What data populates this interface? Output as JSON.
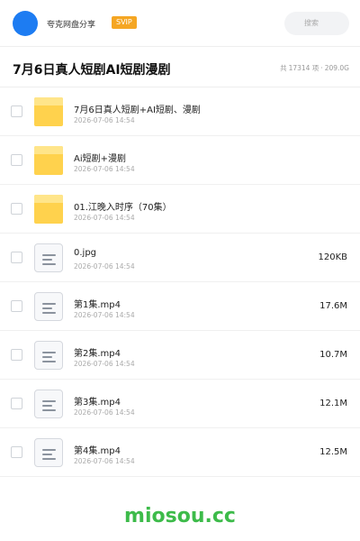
{
  "header": {
    "share_name": "夸克网盘分享",
    "badge": "SVIP",
    "search_placeholder": "搜索"
  },
  "title_bar": {
    "title": "7月6日真人短剧AI短剧漫剧",
    "summary_prefix": "共",
    "count": "17314 项",
    "separator": "·",
    "total_size": "209.0G"
  },
  "files": [
    {
      "type": "folder",
      "name": "7月6日真人短剧+AI短剧、漫剧",
      "date": "2026-07-06 14:54",
      "size": ""
    },
    {
      "type": "folder",
      "name": "Ai短剧+漫剧",
      "date": "2026-07-06 14:54",
      "size": ""
    },
    {
      "type": "folder",
      "name": "01.江晚入时序（70集）",
      "date": "2026-07-06 14:54",
      "size": ""
    },
    {
      "type": "file",
      "name": "0.jpg",
      "date": "2026-07-06 14:54",
      "size": "120KB"
    },
    {
      "type": "file",
      "name": "第1集.mp4",
      "date": "2026-07-06 14:54",
      "size": "17.6M"
    },
    {
      "type": "file",
      "name": "第2集.mp4",
      "date": "2026-07-06 14:54",
      "size": "10.7M"
    },
    {
      "type": "file",
      "name": "第3集.mp4",
      "date": "2026-07-06 14:54",
      "size": "12.1M"
    },
    {
      "type": "file",
      "name": "第4集.mp4",
      "date": "2026-07-06 14:54",
      "size": "12.5M"
    }
  ],
  "watermark": "miosou.cc"
}
